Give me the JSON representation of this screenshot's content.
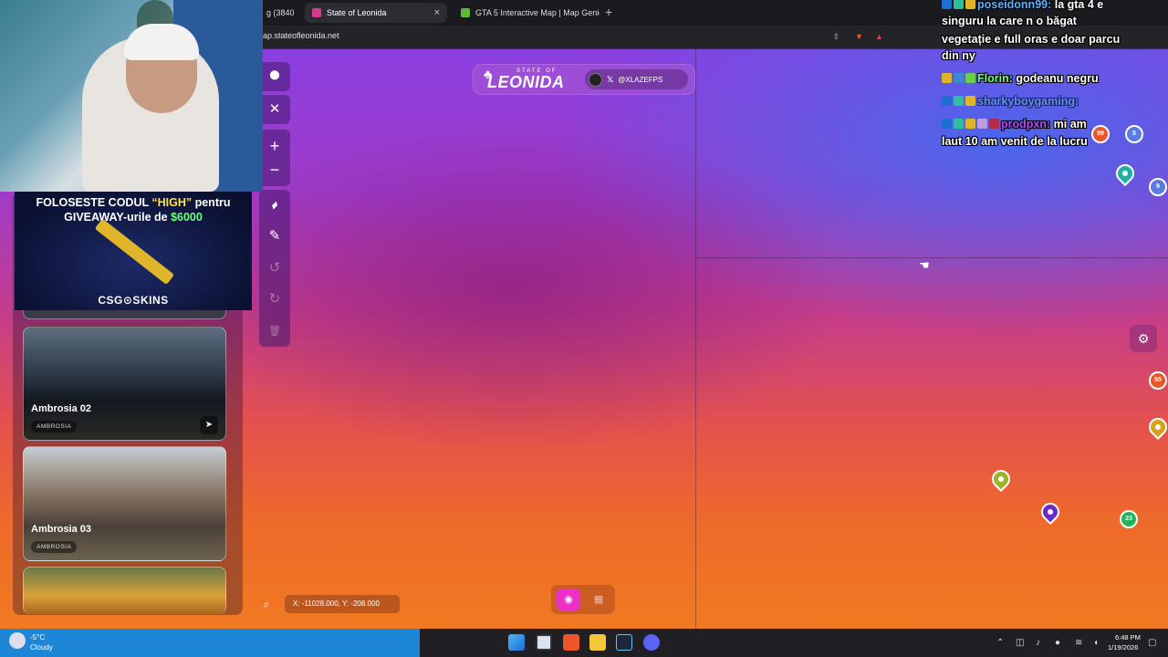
{
  "browser": {
    "tabs": [
      {
        "label": "g (3840",
        "active": false
      },
      {
        "label": "State of Leonida",
        "active": true
      },
      {
        "label": "GTA 5 Interactive Map | Map Genie",
        "active": false
      }
    ],
    "new_tab_symbol": "+",
    "close_symbol": "×",
    "address": "ap.stateofleonida.net"
  },
  "map": {
    "logo_state": "STATE OF",
    "logo_name": "LEONIDA",
    "social_handle": "@XLAZEFPS",
    "social_icon": "x-icon",
    "coords": "X: -11028.000, Y: -208.000",
    "tools": [
      {
        "name": "location-pin-icon",
        "glyph": "⬤"
      },
      {
        "name": "close-icon",
        "glyph": "✕"
      },
      {
        "name": "zoom-in-icon",
        "glyph": "+"
      },
      {
        "name": "zoom-out-icon",
        "glyph": "−"
      },
      {
        "name": "ruler-icon",
        "glyph": "▰"
      },
      {
        "name": "pencil-icon",
        "glyph": "✎"
      },
      {
        "name": "undo-icon",
        "glyph": "↺"
      },
      {
        "name": "redo-icon",
        "glyph": "↻"
      },
      {
        "name": "trash-icon",
        "glyph": "🗑"
      }
    ],
    "markers": {
      "badges": [
        "99",
        "5",
        "9",
        "55",
        "23"
      ],
      "colors": {
        "teal": "#1fb0a8",
        "olive": "#9eb22a",
        "purple": "#6a2ac8",
        "gold": "#d4a21c",
        "orange": "#e8572a",
        "green": "#25b45a"
      }
    }
  },
  "sidebar": {
    "cards": [
      {
        "title": "Ambrosia 02",
        "tag": "AMBROSIA"
      },
      {
        "title": "Ambrosia 03",
        "tag": "AMBROSIA"
      }
    ]
  },
  "promo": {
    "line1_a": "FOLOSESTE CODUL ",
    "line1_code": "“HIGH”",
    "line1_b": " pentru",
    "line2_a": "GIVEAWAY-urile de ",
    "line2_amount": "$6000",
    "brand": "CSG⊙SKINS"
  },
  "chat": {
    "messages": [
      {
        "user": "poseidonn99:",
        "text": " la gta 4 e"
      },
      {
        "text": "singuru la care n o băgat"
      },
      {
        "text": "vegetație e full oras e doar parcu"
      },
      {
        "text": "din ny"
      },
      {
        "user": "Florin:",
        "text": " godeanu negru"
      },
      {
        "user": "sharkyboygaming:",
        "text": ""
      },
      {
        "user": "prodpxn:",
        "text": " mi am"
      },
      {
        "text": "laut 10 am venit de la lucru"
      }
    ]
  },
  "taskbar": {
    "weather_temp": "-5°C",
    "weather_cond": "Cloudy",
    "time": "6:48 PM",
    "date": "1/19/2026"
  }
}
